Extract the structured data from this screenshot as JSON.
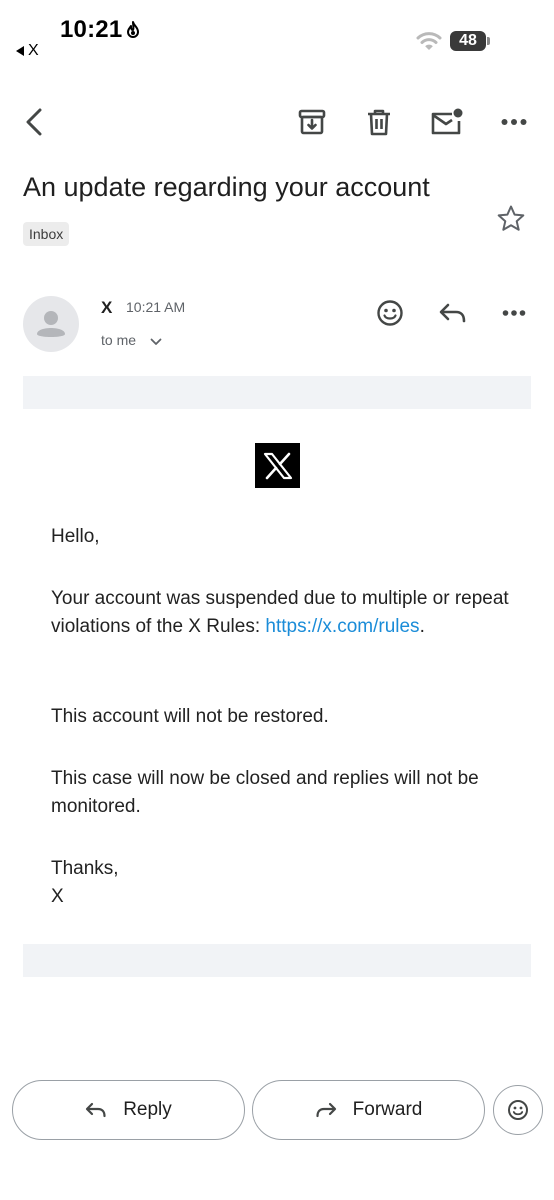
{
  "status_bar": {
    "time": "10:21",
    "back_app_label": "X",
    "battery": "48"
  },
  "toolbar": {
    "icons": [
      "back-arrow-icon",
      "archive-icon",
      "trash-icon",
      "mark-unread-icon",
      "more-vert-icon"
    ]
  },
  "email": {
    "subject": "An update regarding your account",
    "label": "Inbox",
    "sender": "X",
    "time": "10:21 AM",
    "recipient": "to me",
    "body": {
      "greeting": "Hello,",
      "para1": "Your account was suspended due to multiple or repeat violations of the X Rules: ",
      "link": "https://x.com/rules",
      "para1_end": ".",
      "para2": "This account will not be restored.",
      "para3": "This case will now be closed and replies will not be monitored.",
      "signoff": "Thanks,",
      "signature": "X"
    }
  },
  "actions": {
    "reply_label": "Reply",
    "forward_label": "Forward"
  },
  "colors": {
    "link": "#1a8cd8",
    "band": "#f1f3f6",
    "icon": "#444746"
  }
}
